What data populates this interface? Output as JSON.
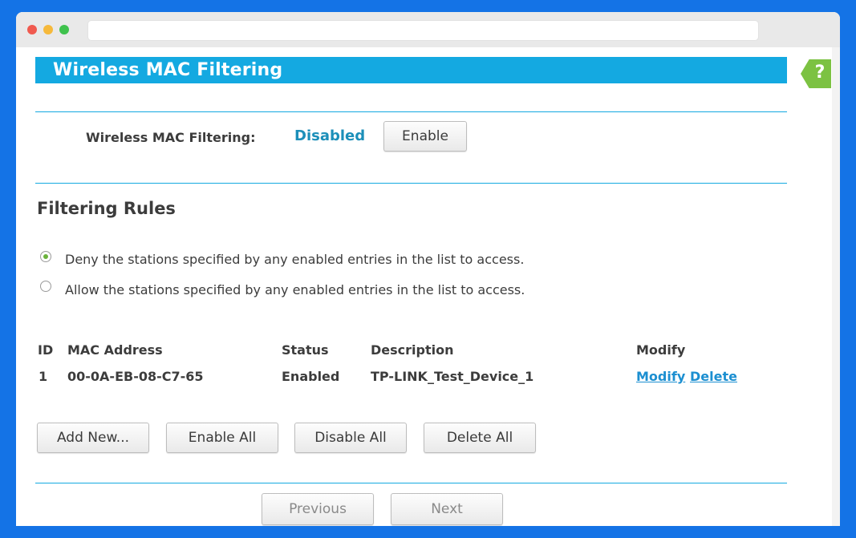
{
  "page": {
    "title": "Wireless MAC Filtering",
    "help_icon": "question-icon",
    "colors": {
      "accent": "#14a9e1",
      "status": "#1c8fb9",
      "link": "#1c8fd1",
      "help": "#7cc242",
      "radio_checked": "#6bb23c"
    }
  },
  "filter_status": {
    "label": "Wireless MAC Filtering:",
    "value": "Disabled",
    "button": "Enable"
  },
  "rules": {
    "title": "Filtering Rules",
    "options": [
      {
        "label": "Deny the stations specified by any enabled entries in the list to access.",
        "selected": true
      },
      {
        "label": "Allow the stations specified by any enabled entries in the list to access.",
        "selected": false
      }
    ]
  },
  "table": {
    "headers": {
      "id": "ID",
      "mac": "MAC Address",
      "status": "Status",
      "description": "Description",
      "modify": "Modify"
    },
    "rows": [
      {
        "id": "1",
        "mac": "00-0A-EB-08-C7-65",
        "status": "Enabled",
        "description": "TP-LINK_Test_Device_1",
        "modify_link": "Modify",
        "delete_link": "Delete"
      }
    ]
  },
  "actions": {
    "add_new": "Add New...",
    "enable_all": "Enable All",
    "disable_all": "Disable All",
    "delete_all": "Delete All"
  },
  "pagination": {
    "previous": "Previous",
    "next": "Next"
  }
}
